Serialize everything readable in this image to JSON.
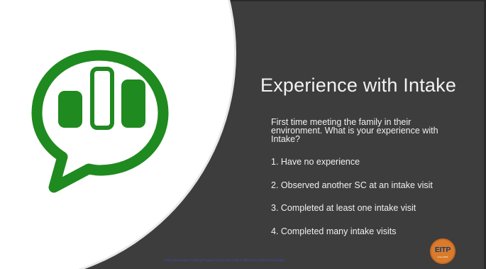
{
  "slide": {
    "title": "Experience with Intake",
    "question": "First time meeting the family in their environment.  What is your experience with Intake?",
    "options": [
      "1.  Have no experience",
      "2.  Observed another SC at an intake visit",
      "3.  Completed at least one intake visit",
      "4.  Completed many intake visits"
    ],
    "footer": "Early Intervention Training Program at the University of Illinois at Urbana-Champaign",
    "logo": {
      "text": "EITP",
      "subtext": "since 2003"
    },
    "icon": "poll-chat-bubble-icon"
  },
  "colors": {
    "background": "#3d3d3d",
    "circle": "#ffffff",
    "icon_green": "#1f8a1f",
    "text": "#f0f0f0",
    "logo_orange": "#d97b2b",
    "logo_navy": "#1b3a6b",
    "footer_blue": "#3a4fb0"
  }
}
